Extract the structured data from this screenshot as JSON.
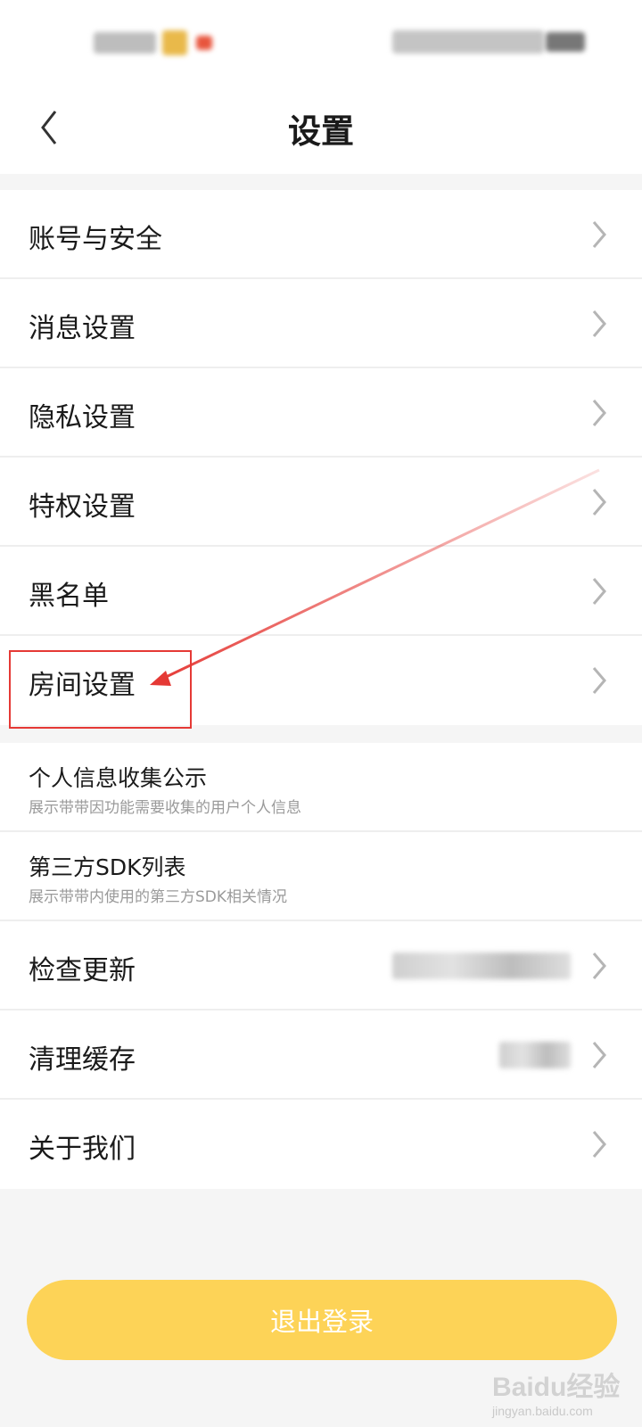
{
  "header": {
    "title": "设置"
  },
  "group1": [
    {
      "label": "账号与安全"
    },
    {
      "label": "消息设置"
    },
    {
      "label": "隐私设置"
    },
    {
      "label": "特权设置"
    },
    {
      "label": "黑名单"
    },
    {
      "label": "房间设置"
    }
  ],
  "group2": [
    {
      "title": "个人信息收集公示",
      "subtitle": "展示带带因功能需要收集的用户个人信息"
    },
    {
      "title": "第三方SDK列表",
      "subtitle": "展示带带内使用的第三方SDK相关情况"
    },
    {
      "label": "检查更新"
    },
    {
      "label": "清理缓存"
    },
    {
      "label": "关于我们"
    }
  ],
  "logout": {
    "label": "退出登录"
  },
  "watermark": {
    "logo": "Baidu经验",
    "url": "jingyan.baidu.com"
  },
  "colors": {
    "accent": "#fdd357",
    "annotation": "#e53935",
    "background": "#f5f5f5"
  },
  "icons": {
    "back": "chevron-left-icon",
    "row_arrow": "chevron-right-icon"
  }
}
